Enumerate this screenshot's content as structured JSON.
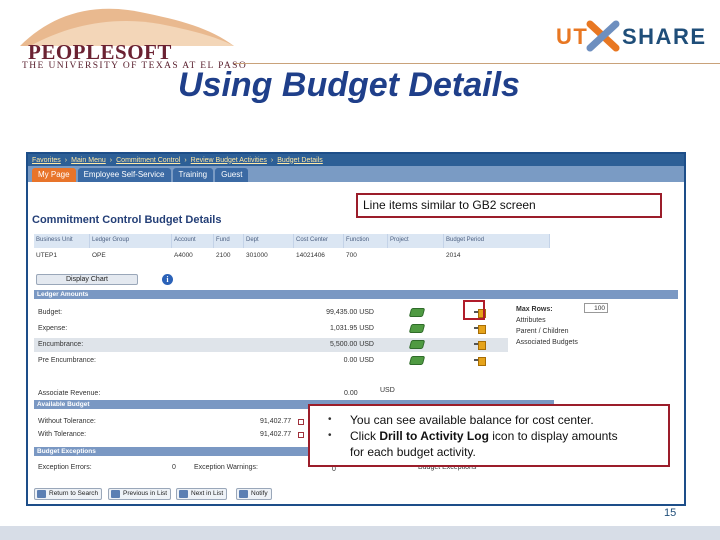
{
  "header": {
    "peoplesoft_word": "PEOPLESOFT",
    "peoplesoft_sub": "THE UNIVERSITY OF TEXAS AT EL PASO",
    "ut_share_left": "UT",
    "ut_share_right": "SHARE",
    "title": "Using Budget Details"
  },
  "colors": {
    "title": "#1f3f8a",
    "callout_border": "#9b1d2a",
    "tab_active": "#e8742a",
    "nav_blue": "#2d5f96",
    "section_blue": "#7a98c3"
  },
  "breadcrumbs": [
    "Favorites",
    "Main Menu",
    "Commitment Control",
    "Review Budget Activities",
    "Budget Details"
  ],
  "tabs": [
    {
      "label": "My Page",
      "active": true
    },
    {
      "label": "Employee Self-Service",
      "active": false
    },
    {
      "label": "Training",
      "active": false
    },
    {
      "label": "Guest",
      "active": false
    }
  ],
  "page_heading": "Commitment Control Budget Details",
  "grid": {
    "headers": [
      "Business Unit",
      "Ledger Group",
      "Account",
      "Fund",
      "Dept",
      "Cost Center",
      "Function",
      "Project",
      "Budget Period"
    ],
    "row": [
      "UTEP1",
      "OPE",
      "A4000",
      "2100",
      "301000",
      "14021406",
      "700",
      "",
      "2014"
    ]
  },
  "display_chart_label": "Display Chart",
  "info_icon_glyph": "i",
  "sections": {
    "ledger_amounts": "Ledger Amounts",
    "available_budget": "Available Budget",
    "budget_exceptions": "Budget Exceptions"
  },
  "ledger_rows": [
    {
      "label": "Budget:",
      "value": "99,435.00 USD",
      "shaded": false
    },
    {
      "label": "Expense:",
      "value": "1,031.95 USD",
      "shaded": false
    },
    {
      "label": "Encumbrance:",
      "value": "5,500.00 USD",
      "shaded": true
    },
    {
      "label": "Pre Encumbrance:",
      "value": "0.00 USD",
      "shaded": false
    }
  ],
  "max_rows": {
    "label": "Max Rows:",
    "value": "100"
  },
  "side_links": [
    "Attributes",
    "Parent / Children",
    "Associated Budgets"
  ],
  "associate_revenue": {
    "label": "Associate Revenue:",
    "value": "0.00",
    "currency": "USD"
  },
  "available_rows": [
    {
      "label": "Without Tolerance:",
      "value": "91,402.77"
    },
    {
      "label": "With Tolerance:",
      "value": "91,402.77"
    }
  ],
  "exceptions": {
    "errors_label": "Exception Errors:",
    "errors_value": "0",
    "warnings_label": "Exception Warnings:",
    "warnings_value": "0",
    "link": "Budget Exceptions"
  },
  "bottom_buttons": [
    "Return to Search",
    "Previous in List",
    "Next in List",
    "Notify"
  ],
  "callout_top": "Line items similar to GB2 screen",
  "callout_bottom": {
    "bullet1": "You can see available balance for cost center.",
    "bullet2_pre": "Click ",
    "bullet2_bold": "Drill to Activity Log",
    "bullet2_post": " icon to display amounts",
    "bullet2_cont": "for each budget activity."
  },
  "bullet_glyph": "•",
  "page_number": "15"
}
